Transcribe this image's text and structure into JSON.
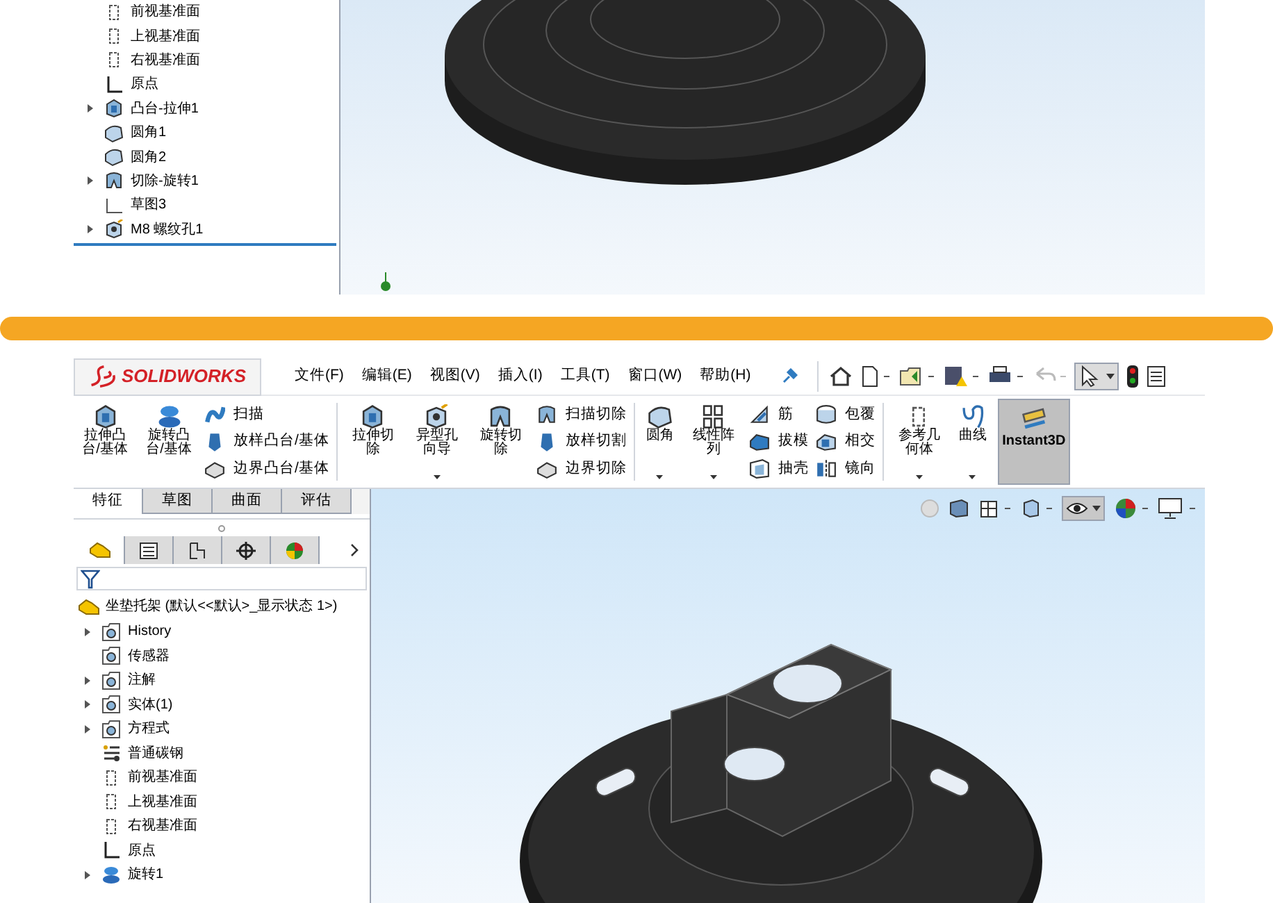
{
  "top_shot": {
    "tree": [
      {
        "label": "前视基准面",
        "kind": "plane",
        "expandable": false
      },
      {
        "label": "上视基准面",
        "kind": "plane",
        "expandable": false
      },
      {
        "label": "右视基准面",
        "kind": "plane",
        "expandable": false
      },
      {
        "label": "原点",
        "kind": "origin",
        "expandable": false
      },
      {
        "label": "凸台-拉伸1",
        "kind": "extrude",
        "expandable": true
      },
      {
        "label": "圆角1",
        "kind": "fillet",
        "expandable": false
      },
      {
        "label": "圆角2",
        "kind": "fillet",
        "expandable": false
      },
      {
        "label": "切除-旋转1",
        "kind": "cut",
        "expandable": true
      },
      {
        "label": "草图3",
        "kind": "sketch",
        "expandable": false
      },
      {
        "label": "M8 螺纹孔1",
        "kind": "hole",
        "expandable": true
      }
    ]
  },
  "bottom_shot": {
    "logo": "SOLIDWORKS",
    "menus": [
      "文件(F)",
      "编辑(E)",
      "视图(V)",
      "插入(I)",
      "工具(T)",
      "窗口(W)",
      "帮助(H)"
    ],
    "toolbar_groups": [
      [
        {
          "kind": "large",
          "label": "拉伸凸台/基体",
          "dropdown": false,
          "selected": false
        },
        {
          "kind": "large",
          "label": "旋转凸台/基体",
          "dropdown": false,
          "selected": false
        },
        {
          "kind": "column",
          "items": [
            "扫描",
            "放样凸台/基体",
            "边界凸台/基体"
          ]
        }
      ],
      [
        {
          "kind": "large",
          "label": "拉伸切除",
          "dropdown": false,
          "selected": false
        },
        {
          "kind": "large",
          "label": "异型孔向导",
          "dropdown": true,
          "selected": false
        },
        {
          "kind": "large",
          "label": "旋转切除",
          "dropdown": false,
          "selected": false
        },
        {
          "kind": "column",
          "items": [
            "扫描切除",
            "放样切割",
            "边界切除"
          ]
        }
      ],
      [
        {
          "kind": "large",
          "label": "圆角",
          "dropdown": true,
          "selected": false
        },
        {
          "kind": "large",
          "label": "线性阵列",
          "dropdown": true,
          "selected": false
        },
        {
          "kind": "column",
          "items": [
            "筋",
            "拔模",
            "抽壳"
          ]
        },
        {
          "kind": "column",
          "items": [
            "包覆",
            "相交",
            "镜向"
          ]
        }
      ],
      [
        {
          "kind": "large",
          "label": "参考几何体",
          "dropdown": true,
          "selected": false
        },
        {
          "kind": "large",
          "label": "曲线",
          "dropdown": true,
          "selected": false
        },
        {
          "kind": "large",
          "label": "Instant3D",
          "dropdown": false,
          "selected": true
        }
      ]
    ],
    "tabs": [
      {
        "label": "特征",
        "selected": true
      },
      {
        "label": "草图",
        "selected": false
      },
      {
        "label": "曲面",
        "selected": false
      },
      {
        "label": "评估",
        "selected": false
      }
    ],
    "panel_tabs": [
      {
        "selected": true
      },
      {
        "selected": false
      },
      {
        "selected": false
      },
      {
        "selected": false
      },
      {
        "selected": false
      }
    ],
    "root": "坐垫托架  (默认<<默认>_显示状态 1>)",
    "tree": [
      {
        "label": "History",
        "kind": "folder",
        "expandable": true
      },
      {
        "label": "传感器",
        "kind": "folder",
        "expandable": false
      },
      {
        "label": "注解",
        "kind": "folder",
        "expandable": true
      },
      {
        "label": "实体(1)",
        "kind": "folder",
        "expandable": true
      },
      {
        "label": "方程式",
        "kind": "folder",
        "expandable": true
      },
      {
        "label": "普通碳钢",
        "kind": "material",
        "expandable": false
      },
      {
        "label": "前视基准面",
        "kind": "plane",
        "expandable": false
      },
      {
        "label": "上视基准面",
        "kind": "plane",
        "expandable": false
      },
      {
        "label": "右视基准面",
        "kind": "plane",
        "expandable": false
      },
      {
        "label": "原点",
        "kind": "origin",
        "expandable": false
      },
      {
        "label": "旋转1",
        "kind": "revolve",
        "expandable": true
      }
    ]
  }
}
